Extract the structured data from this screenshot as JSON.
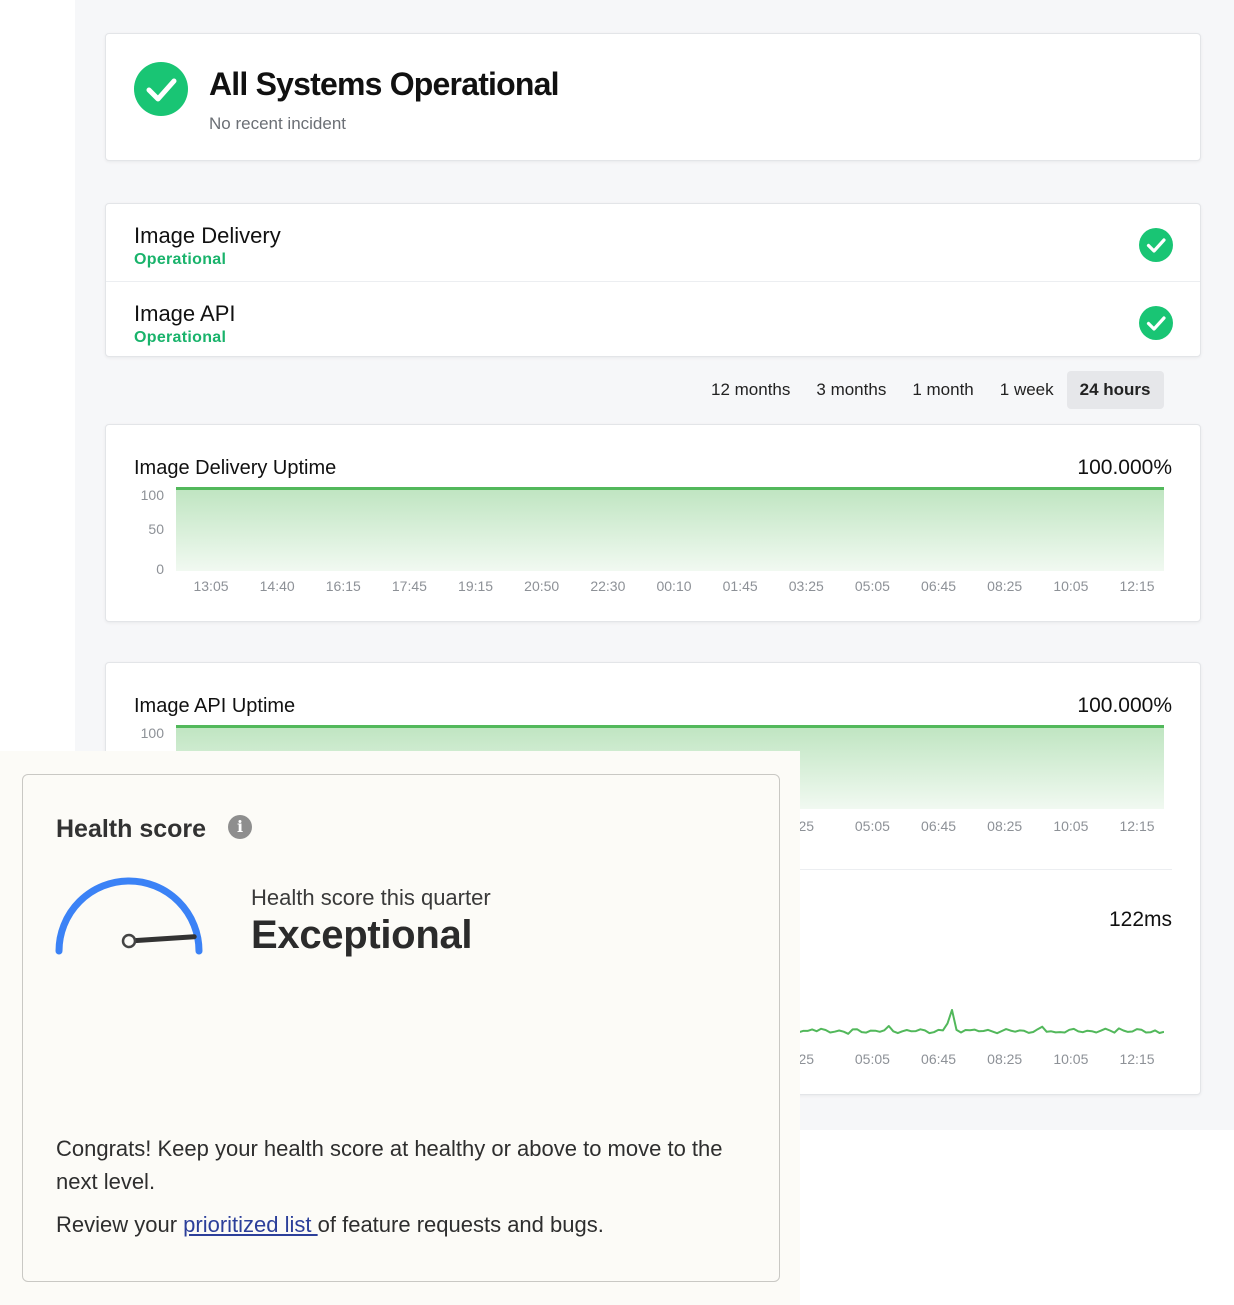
{
  "banner": {
    "title": "All Systems Operational",
    "subtitle": "No recent incident"
  },
  "components": [
    {
      "name": "Image Delivery",
      "status": "Operational"
    },
    {
      "name": "Image API",
      "status": "Operational"
    }
  ],
  "range_tabs": [
    {
      "label": "12 months",
      "active": false
    },
    {
      "label": "3 months",
      "active": false
    },
    {
      "label": "1 month",
      "active": false
    },
    {
      "label": "1 week",
      "active": false
    },
    {
      "label": "24 hours",
      "active": true
    }
  ],
  "uptime_charts": [
    {
      "title": "Image Delivery Uptime",
      "value": "100.000%",
      "yticks": [
        "100",
        "50",
        "0"
      ],
      "xticks": [
        "13:05",
        "14:40",
        "16:15",
        "17:45",
        "19:15",
        "20:50",
        "22:30",
        "00:10",
        "01:45",
        "03:25",
        "05:05",
        "06:45",
        "08:25",
        "10:05",
        "12:15"
      ]
    },
    {
      "title": "Image API Uptime",
      "value": "100.000%",
      "yticks": [
        "100"
      ],
      "xticks_visible": [
        "25",
        "05:05",
        "06:45",
        "08:25",
        "10:05",
        "12:15"
      ]
    }
  ],
  "latency": {
    "value": "122ms",
    "xticks_visible": [
      "25",
      "05:05",
      "06:45",
      "08:25",
      "10:05",
      "12:15"
    ]
  },
  "health": {
    "title": "Health score",
    "info_icon": "info-icon",
    "subtitle": "Health score this quarter",
    "level": "Exceptional",
    "score_fraction": 0.95,
    "congrats": "Congrats! Keep your health score at healthy or above to move to the next level.",
    "review_prefix": "Review your ",
    "review_link": "prioritized list ",
    "review_suffix": "of feature requests and bugs."
  },
  "colors": {
    "operational": "#19c574",
    "chart_line": "#52b85b",
    "gauge": "#3b82f6",
    "link": "#2c3f9a"
  },
  "chart_data": [
    {
      "type": "area",
      "title": "Image Delivery Uptime",
      "xlabel": "",
      "ylabel": "",
      "x": [
        "13:05",
        "14:40",
        "16:15",
        "17:45",
        "19:15",
        "20:50",
        "22:30",
        "00:10",
        "01:45",
        "03:25",
        "05:05",
        "06:45",
        "08:25",
        "10:05",
        "12:15"
      ],
      "series": [
        {
          "values": [
            100,
            100,
            100,
            100,
            100,
            100,
            100,
            100,
            100,
            100,
            100,
            100,
            100,
            100,
            100
          ]
        }
      ],
      "ylim": [
        0,
        100
      ],
      "grid": false
    },
    {
      "type": "area",
      "title": "Image API Uptime",
      "xlabel": "",
      "ylabel": "",
      "x": [
        "05:05",
        "06:45",
        "08:25",
        "10:05",
        "12:15"
      ],
      "series": [
        {
          "values": [
            100,
            100,
            100,
            100,
            100
          ]
        }
      ],
      "ylim": [
        0,
        100
      ],
      "grid": false
    },
    {
      "type": "line",
      "title": "",
      "xlabel": "",
      "ylabel": "",
      "x": [
        "05:05",
        "06:45",
        "08:25",
        "10:05",
        "12:15"
      ],
      "series": [
        {
          "values": [
            120,
            123,
            121,
            122,
            122
          ]
        }
      ],
      "grid": false
    }
  ]
}
